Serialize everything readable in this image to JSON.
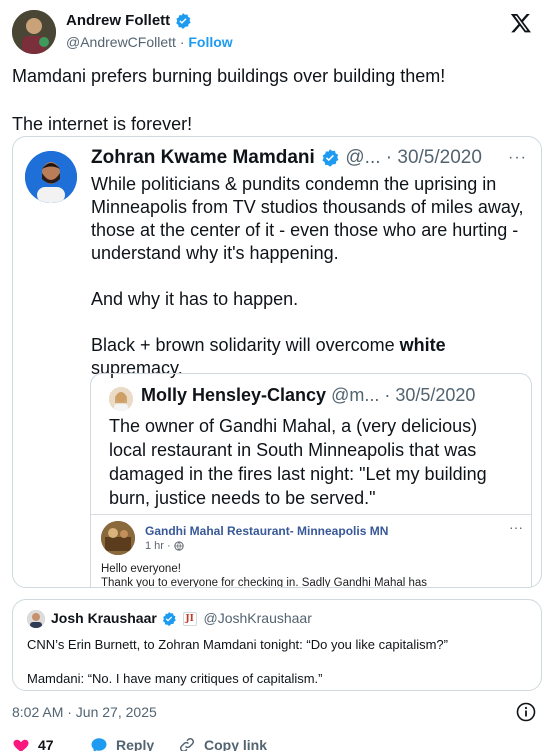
{
  "tweet": {
    "author_name": "Andrew Follett",
    "author_handle": "@AndrewCFollett",
    "separator": "·",
    "follow_label": "Follow",
    "text": "Mamdani prefers burning buildings over building them!\n\nThe internet is forever!",
    "timestamp": "8:02 AM · Jun 27, 2025"
  },
  "quote1": {
    "name": "Zohran Kwame Mamdani",
    "meta": "@... · 30/5/2020",
    "more": "···",
    "paragraph1": "While politicians & pundits condemn the uprising in Minneapolis from TV studios thousands of miles away, those at the center of it - even those who are hurting - understand why it's happening.",
    "paragraph2": "And why it has to happen.",
    "paragraph3_before": "Black + brown solidarity will overcome ",
    "paragraph3_bold": "white",
    "paragraph3_after": " supremacy."
  },
  "quote2": {
    "name": "Molly Hensley-Clancy",
    "meta": "@m... · 30/5/2020",
    "text": "The owner of Gandhi Mahal, a (very delicious) local restaurant in South Minneapolis that was damaged in the fires last night: \"Let my building burn, justice needs to be served.\"",
    "fb": {
      "page_name": "Gandhi Mahal Restaurant- Minneapolis MN",
      "time": "1 hr ·",
      "more": "···",
      "line1": "Hello everyone!",
      "line2": "Thank you to everyone for checking in. Sadly Gandhi Mahal has"
    }
  },
  "quote3": {
    "name": "Josh Kraushaar",
    "badge": "JI",
    "handle": "@JoshKraushaar",
    "paragraph1": "CNN’s Erin Burnett, to Zohran Mamdani tonight: “Do you like capitalism?”",
    "paragraph2": "Mamdani: “No. I have many critiques of capitalism.”"
  },
  "actions": {
    "like_count": "47",
    "reply_label": "Reply",
    "copy_label": "Copy link"
  },
  "colors": {
    "accent": "#1d9bf0",
    "like": "#f91880",
    "muted": "#536471",
    "border": "#cfd9de"
  }
}
